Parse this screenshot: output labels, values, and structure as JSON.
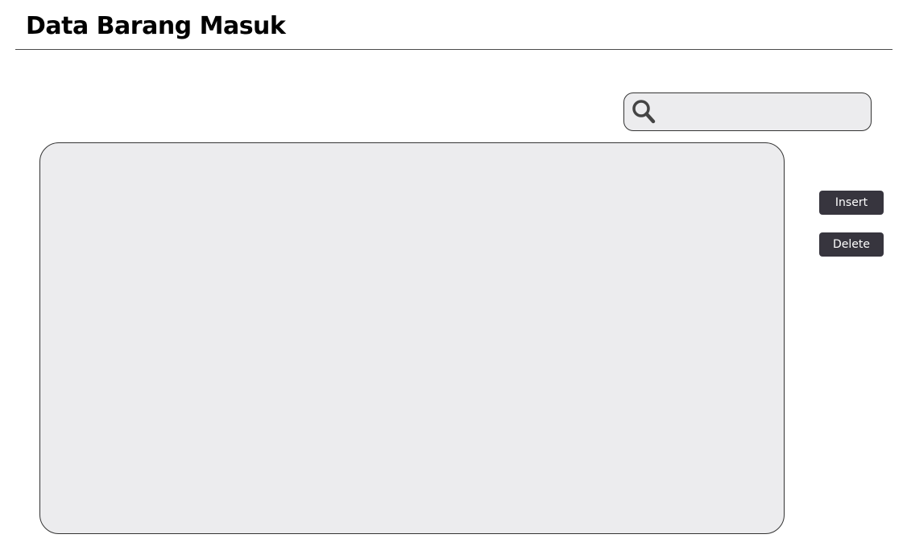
{
  "header": {
    "title": "Data Barang Masuk"
  },
  "search": {
    "icon": "search-icon",
    "value": "",
    "placeholder": ""
  },
  "actions": {
    "insert_label": "Insert",
    "delete_label": "Delete"
  },
  "colors": {
    "panel_background": "#ececee",
    "button_background": "#37353e",
    "button_text": "#ffffff",
    "border": "#333333"
  }
}
